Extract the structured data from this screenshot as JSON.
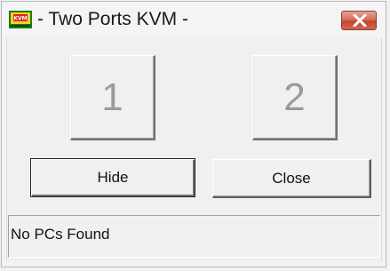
{
  "window": {
    "title": "- Two Ports KVM -",
    "app_icon": "kvm-app-icon",
    "close_icon": "close-icon",
    "colors": {
      "close_button": "#c4452f",
      "background": "#f0f0f0"
    }
  },
  "ports": [
    {
      "label": "1"
    },
    {
      "label": "2"
    }
  ],
  "actions": {
    "hide_label": "Hide",
    "close_label": "Close"
  },
  "status": {
    "text": "No PCs Found"
  }
}
